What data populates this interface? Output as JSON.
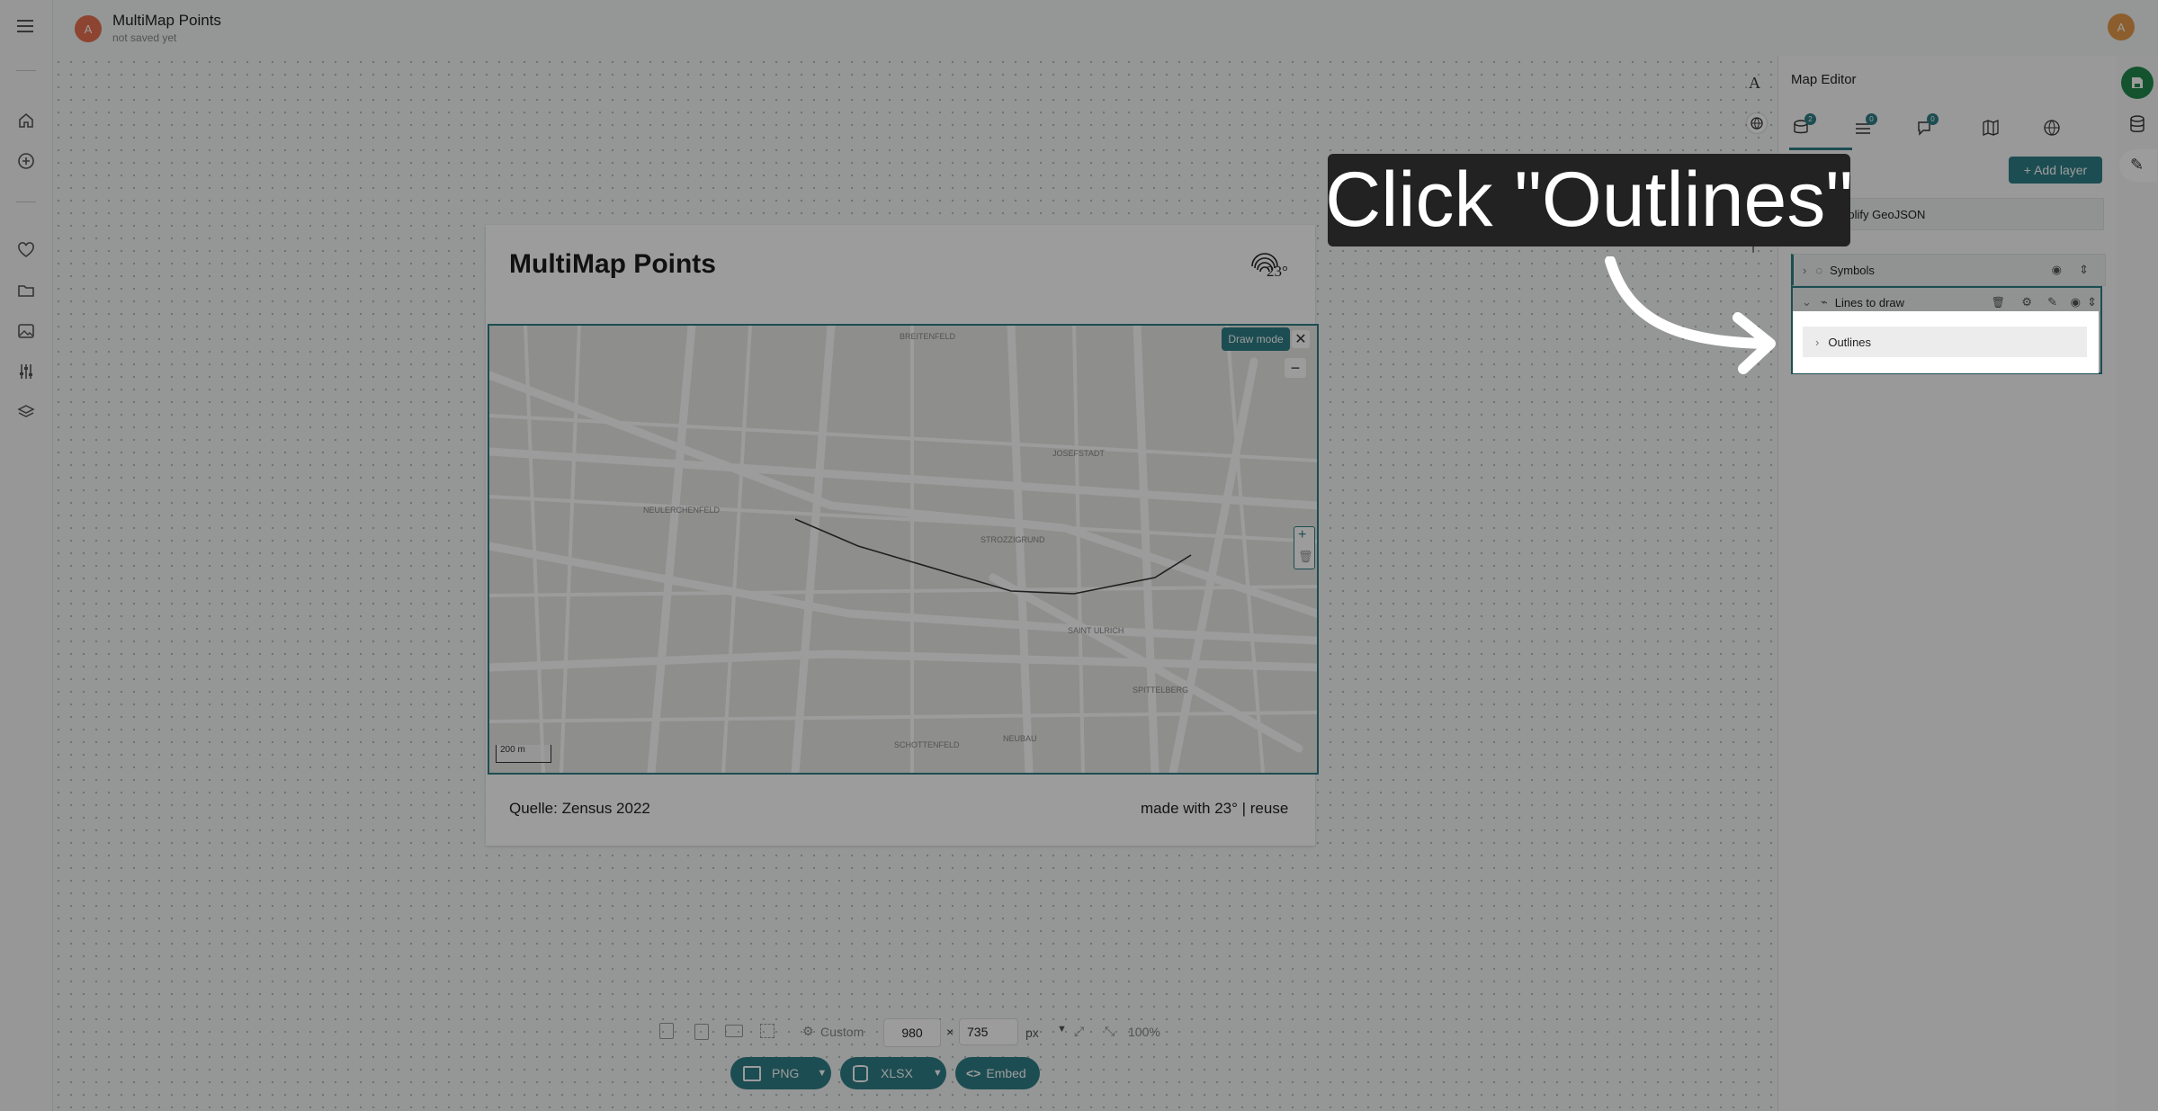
{
  "header": {
    "avatar_letter": "A",
    "title": "MultiMap Points",
    "subtitle": "not saved yet",
    "user_letter": "A"
  },
  "card": {
    "title": "MultiMap Points",
    "logo_text": "23°",
    "draw_mode_label": "Draw mode",
    "zoom_out": "−",
    "zoom_in": "+",
    "scale_label": "200 m",
    "source": "Quelle: Zensus 2022",
    "made_with": "made with 23° | reuse",
    "districts": [
      "BREITENFELD",
      "JOSEFSTADT",
      "NEULERCHENFELD",
      "STROZZIGRUND",
      "SAINT ULRICH",
      "SPITTELBERG",
      "SCHOTTENFELD",
      "NEUBAU"
    ]
  },
  "panel": {
    "title": "Map Editor",
    "tab_badges": [
      "2",
      "0",
      "0"
    ],
    "add_layer_label": "+ Add layer",
    "simplify_label": "Simplify GeoJSON",
    "layers": [
      {
        "label": "Symbols"
      },
      {
        "label": "Lines to draw"
      }
    ],
    "sublayer_label": "Outlines"
  },
  "tool_strip": {
    "text_icon": "A"
  },
  "callout": {
    "text": "Click \"Outlines\""
  },
  "bottom_bar": {
    "size_mode": "Custom",
    "width_value": "980",
    "times": "×",
    "height_value": "735",
    "unit": "px",
    "zoom": "100%",
    "png_label": "PNG",
    "xlsx_label": "XLSX",
    "embed_label": "Embed"
  }
}
